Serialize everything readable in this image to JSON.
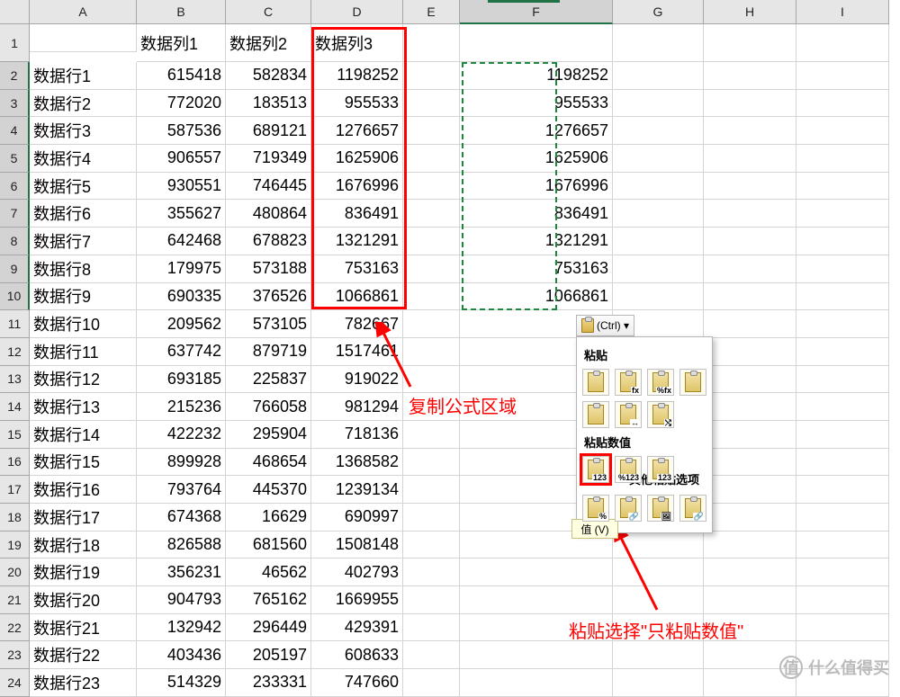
{
  "columns": [
    "A",
    "B",
    "C",
    "D",
    "E",
    "F",
    "G",
    "H",
    "I"
  ],
  "headerRow": {
    "b": "数据列1",
    "c": "数据列2",
    "d": "数据列3"
  },
  "rows": [
    {
      "a": "数据行1",
      "b": 615418,
      "c": 582834,
      "d": 1198252,
      "f": 1198252
    },
    {
      "a": "数据行2",
      "b": 772020,
      "c": 183513,
      "d": 955533,
      "f": 955533
    },
    {
      "a": "数据行3",
      "b": 587536,
      "c": 689121,
      "d": 1276657,
      "f": 1276657
    },
    {
      "a": "数据行4",
      "b": 906557,
      "c": 719349,
      "d": 1625906,
      "f": 1625906
    },
    {
      "a": "数据行5",
      "b": 930551,
      "c": 746445,
      "d": 1676996,
      "f": 1676996
    },
    {
      "a": "数据行6",
      "b": 355627,
      "c": 480864,
      "d": 836491,
      "f": 836491
    },
    {
      "a": "数据行7",
      "b": 642468,
      "c": 678823,
      "d": 1321291,
      "f": 1321291
    },
    {
      "a": "数据行8",
      "b": 179975,
      "c": 573188,
      "d": 753163,
      "f": 753163
    },
    {
      "a": "数据行9",
      "b": 690335,
      "c": 376526,
      "d": 1066861,
      "f": 1066861
    },
    {
      "a": "数据行10",
      "b": 209562,
      "c": 573105,
      "d": 782667
    },
    {
      "a": "数据行11",
      "b": 637742,
      "c": 879719,
      "d": 1517461
    },
    {
      "a": "数据行12",
      "b": 693185,
      "c": 225837,
      "d": 919022
    },
    {
      "a": "数据行13",
      "b": 215236,
      "c": 766058,
      "d": 981294
    },
    {
      "a": "数据行14",
      "b": 422232,
      "c": 295904,
      "d": 718136
    },
    {
      "a": "数据行15",
      "b": 899928,
      "c": 468654,
      "d": 1368582
    },
    {
      "a": "数据行16",
      "b": 793764,
      "c": 445370,
      "d": 1239134
    },
    {
      "a": "数据行17",
      "b": 674368,
      "c": 16629,
      "d": 690997
    },
    {
      "a": "数据行18",
      "b": 826588,
      "c": 681560,
      "d": 1508148
    },
    {
      "a": "数据行19",
      "b": 356231,
      "c": 46562,
      "d": 402793
    },
    {
      "a": "数据行20",
      "b": 904793,
      "c": 765162,
      "d": 1669955
    },
    {
      "a": "数据行21",
      "b": 132942,
      "c": 296449,
      "d": 429391
    },
    {
      "a": "数据行22",
      "b": 403436,
      "c": 205197,
      "d": 608633
    },
    {
      "a": "数据行23",
      "b": 514329,
      "c": 233331,
      "d": 747660
    }
  ],
  "annotations": {
    "copyArea": "复制公式区域",
    "pasteChoice": "粘贴选择\"只粘贴数值\""
  },
  "pasteOptions": {
    "ctrlLabel": "(Ctrl) ▾",
    "sectionPaste": "粘贴",
    "sectionValues": "粘贴数值",
    "sectionOther": "其他粘贴选项",
    "valHint": "值 (V)",
    "icons": {
      "paste": "",
      "fx": "fx",
      "fxfmt": "%fx",
      "src": "",
      "noborder": "",
      "colwidth": "↔",
      "transpose": "⤭",
      "values": "123",
      "valuesFmt": "%123",
      "valuesSrc": "123",
      "fmt": "%",
      "link": "🔗",
      "pic": "🖼",
      "picLink": "🔗"
    }
  },
  "watermark": "什么值得买"
}
